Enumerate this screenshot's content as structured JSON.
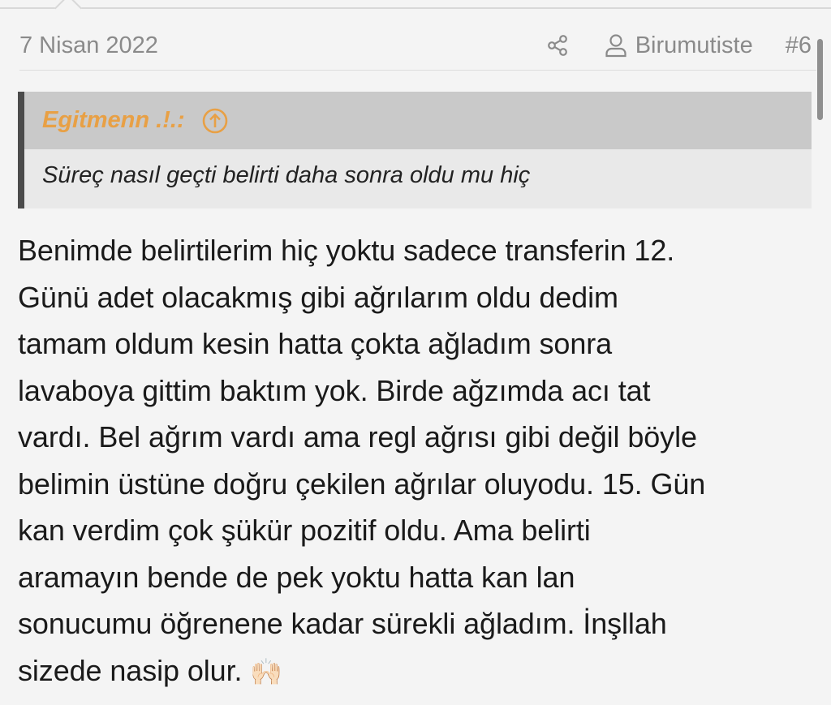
{
  "post": {
    "date": "7 Nisan 2022",
    "author": "Birumutiste",
    "number": "#6"
  },
  "quote": {
    "author": "Egitmenn .!.:",
    "text": "Süreç nasıl geçti belirti daha sonra oldu mu hiç"
  },
  "body": {
    "lines": [
      "Benimde belirtilerim hiç yoktu sadece transferin 12.",
      "Günü adet olacakmış gibi ağrılarım oldu dedim",
      "tamam oldum kesin hatta çokta ağladım sonra",
      "lavaboya gittim baktım yok. Birde ağzımda acı tat",
      "vardı. Bel ağrım vardı ama regl ağrısı gibi değil böyle",
      "belimin üstüne doğru çekilen ağrılar oluyodu. 15. Gün",
      "kan verdim çok şükür pozitif oldu. Ama belirti",
      "aramayın bende de pek yoktu hatta kan lan",
      "sonucumu öğrenene kadar sürekli ağladım. İnşllah",
      "sizede nasip olur."
    ],
    "emoji": "🙌🏻"
  },
  "icons": {
    "share": "share-icon",
    "user": "user-icon",
    "jump": "arrow-up-circle-icon"
  },
  "colors": {
    "quote_author": "#e8a045",
    "meta_text": "#8a8a8a",
    "quote_bar": "#4b4b4b"
  }
}
